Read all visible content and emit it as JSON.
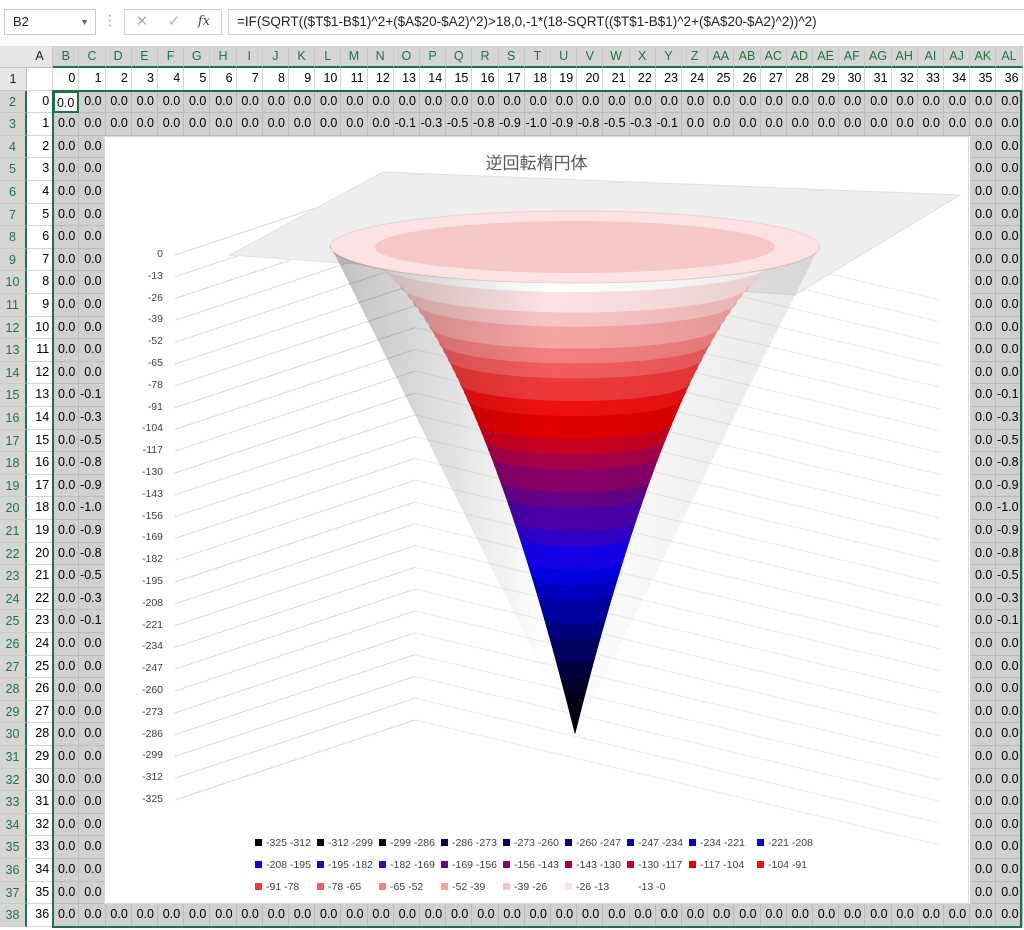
{
  "name_box": "B2",
  "formula": "=IF(SQRT(($T$1-B$1)^2+($A$20-$A2)^2)>18,0,-1*(18-SQRT(($T$1-B$1)^2+($A$20-$A2)^2))^2)",
  "formula_buttons": {
    "cancel": "✕",
    "enter": "✓",
    "fx": "fx"
  },
  "columns": [
    "A",
    "B",
    "C",
    "D",
    "E",
    "F",
    "G",
    "H",
    "I",
    "J",
    "K",
    "L",
    "M",
    "N",
    "O",
    "P",
    "Q",
    "R",
    "S",
    "T",
    "U",
    "V",
    "W",
    "X",
    "Y",
    "Z",
    "AA",
    "AB",
    "AC",
    "AD",
    "AE",
    "AF",
    "AG",
    "AH",
    "AI",
    "AJ",
    "AK",
    "AL"
  ],
  "rows": [
    "1",
    "2",
    "3",
    "4",
    "5",
    "6",
    "7",
    "8",
    "9",
    "10",
    "11",
    "12",
    "13",
    "14",
    "15",
    "16",
    "17",
    "18",
    "19",
    "20",
    "21",
    "22",
    "23",
    "24",
    "25",
    "26",
    "27",
    "28",
    "29",
    "30",
    "31",
    "32",
    "33",
    "34",
    "35",
    "36",
    "37",
    "38"
  ],
  "row1_header_values": [
    "0",
    "1",
    "2",
    "3",
    "4",
    "5",
    "6",
    "7",
    "8",
    "9",
    "10",
    "11",
    "12",
    "13",
    "14",
    "15",
    "16",
    "17",
    "18",
    "19",
    "20",
    "21",
    "22",
    "23",
    "24",
    "25",
    "26",
    "27",
    "28",
    "29",
    "30",
    "31",
    "32",
    "33",
    "34",
    "35",
    "36"
  ],
  "col_a_values": [
    "0",
    "1",
    "2",
    "3",
    "4",
    "5",
    "6",
    "7",
    "8",
    "9",
    "10",
    "11",
    "12",
    "13",
    "14",
    "15",
    "16",
    "17",
    "18",
    "19",
    "20",
    "21",
    "22",
    "23",
    "24",
    "25",
    "26",
    "27",
    "28",
    "29",
    "30",
    "31",
    "32",
    "33",
    "34",
    "35",
    "36"
  ],
  "row3_values": [
    "0.0",
    "0.0",
    "0.0",
    "0.0",
    "0.0",
    "0.0",
    "0.0",
    "0.0",
    "0.0",
    "0.0",
    "0.0",
    "0.0",
    "0.0",
    "-0.1",
    "-0.3",
    "-0.5",
    "-0.8",
    "-0.9",
    "-1.0",
    "-0.9",
    "-0.8",
    "-0.5",
    "-0.3",
    "-0.1",
    "0.0",
    "0.0",
    "0.0",
    "0.0",
    "0.0",
    "0.0",
    "0.0",
    "0.0",
    "0.0",
    "0.0",
    "0.0",
    "0.0",
    "0.0"
  ],
  "col_c_values": [
    "0.0",
    "0.0",
    "0.0",
    "0.0",
    "0.0",
    "0.0",
    "0.0",
    "0.0",
    "0.0",
    "0.0",
    "0.0",
    "0.0",
    "0.0",
    "-0.1",
    "-0.3",
    "-0.5",
    "-0.8",
    "-0.9",
    "-1.0",
    "-0.9",
    "-0.8",
    "-0.5",
    "-0.3",
    "-0.1",
    "0.0",
    "0.0",
    "0.0",
    "0.0",
    "0.0",
    "0.0",
    "0.0",
    "0.0",
    "0.0",
    "0.0",
    "0.0",
    "0.0",
    "0.0"
  ],
  "col_al_values": [
    "0.0",
    "0.0",
    "0.0",
    "0.0",
    "0.0",
    "0.0",
    "0.0",
    "0.0",
    "0.0",
    "0.0",
    "0.0",
    "0.0",
    "0.0",
    "-0.1",
    "-0.3",
    "-0.5",
    "-0.8",
    "-0.9",
    "-1.0",
    "-0.9",
    "-0.8",
    "-0.5",
    "-0.3",
    "-0.1",
    "0.0",
    "0.0",
    "0.0",
    "0.0",
    "0.0",
    "0.0",
    "0.0",
    "0.0",
    "0.0",
    "0.0",
    "0.0",
    "0.0",
    "0.0"
  ],
  "default_cell_value": "0.0",
  "colors": {
    "grid_selection": "#1e7145",
    "sheet_grey": "#d0d0d0",
    "header": "#e6e6e6"
  },
  "chart_data": {
    "type": "surface",
    "title": "逆回転楕円体",
    "z_ticks": [
      "0",
      "-13",
      "-26",
      "-39",
      "-52",
      "-65",
      "-78",
      "-91",
      "-104",
      "-117",
      "-130",
      "-143",
      "-156",
      "-169",
      "-182",
      "-195",
      "-208",
      "-221",
      "-234",
      "-247",
      "-260",
      "-273",
      "-286",
      "-299",
      "-312",
      "-325"
    ],
    "zlim": [
      -325,
      0
    ],
    "surface_formula": "z = -(18 - r)^2 if r <= 18 else 0, r = distance from (19,19)",
    "legend_position": "bottom",
    "legend": [
      {
        "label": "-325 -312",
        "color": "#000000"
      },
      {
        "label": "-312 -299",
        "color": "#000010"
      },
      {
        "label": "-299 -286",
        "color": "#000028"
      },
      {
        "label": "-286 -273",
        "color": "#000040"
      },
      {
        "label": "-273 -260",
        "color": "#000060"
      },
      {
        "label": "-260 -247",
        "color": "#000080"
      },
      {
        "label": "-247 -234",
        "color": "#0000a0"
      },
      {
        "label": "-234 -221",
        "color": "#0000c0"
      },
      {
        "label": "-221 -208",
        "color": "#0000e0"
      },
      {
        "label": "-208 -195",
        "color": "#1400e8"
      },
      {
        "label": "-195 -182",
        "color": "#3000c8"
      },
      {
        "label": "-182 -169",
        "color": "#4a00a8"
      },
      {
        "label": "-169 -156",
        "color": "#660088"
      },
      {
        "label": "-156 -143",
        "color": "#880068"
      },
      {
        "label": "-143 -130",
        "color": "#a80048"
      },
      {
        "label": "-130 -117",
        "color": "#c80020"
      },
      {
        "label": "-117 -104",
        "color": "#e00000"
      },
      {
        "label": "-104 -91",
        "color": "#ee1010"
      },
      {
        "label": "-91 -78",
        "color": "#f03838"
      },
      {
        "label": "-78 -65",
        "color": "#f25c5c"
      },
      {
        "label": "-65 -52",
        "color": "#f48080"
      },
      {
        "label": "-52 -39",
        "color": "#f7a4a4"
      },
      {
        "label": "-39 -26",
        "color": "#fac4c4"
      },
      {
        "label": "-26 -13",
        "color": "#fde2e2"
      },
      {
        "label": "-13 -0",
        "color": "#ffffff"
      }
    ]
  }
}
